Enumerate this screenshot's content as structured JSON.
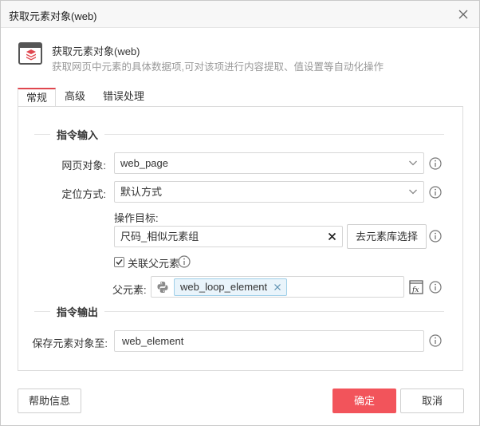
{
  "window": {
    "title": "获取元素对象(web)"
  },
  "header": {
    "name": "获取元素对象(web)",
    "description": "获取网页中元素的具体数据项,可对该项进行内容提取、值设置等自动化操作"
  },
  "tabs": [
    {
      "label": "常规",
      "active": true
    },
    {
      "label": "高级",
      "active": false
    },
    {
      "label": "错误处理",
      "active": false
    }
  ],
  "input_section": {
    "title": "指令输入",
    "web_object": {
      "label": "网页对象:",
      "value": "web_page"
    },
    "locate_mode": {
      "label": "定位方式:",
      "value": "默认方式"
    },
    "target": {
      "label": "操作目标:",
      "value": "尺码_相似元素组",
      "library_button": "去元素库选择"
    },
    "link_parent": {
      "label": "关联父元素",
      "checked": true
    },
    "parent": {
      "label": "父元素:",
      "tag": "web_loop_element"
    }
  },
  "output_section": {
    "title": "指令输出",
    "save_to": {
      "label": "保存元素对象至:",
      "value": "web_element"
    }
  },
  "footer": {
    "help": "帮助信息",
    "ok": "确定",
    "cancel": "取消"
  },
  "colors": {
    "accent": "#f2545b",
    "tab_active": "#e0474f",
    "tag_bg": "#e9f4fb",
    "tag_border": "#9fcfe8"
  },
  "icons": [
    "close-icon",
    "command-icon",
    "chevron-down-icon",
    "info-icon",
    "clear-icon",
    "python-icon",
    "fx-icon",
    "check-icon"
  ]
}
